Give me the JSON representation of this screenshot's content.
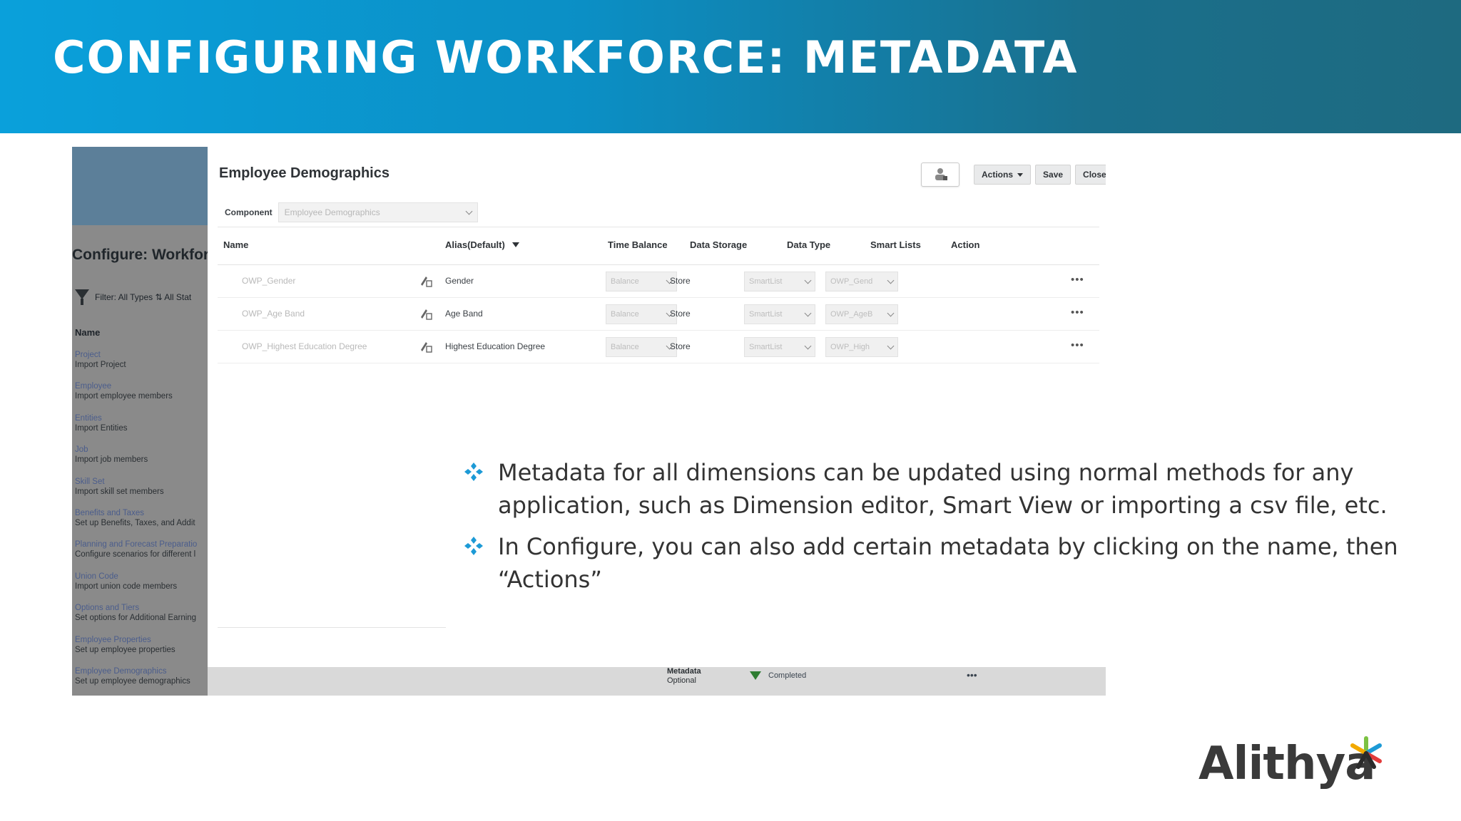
{
  "slide": {
    "title": "CONFIGURING WORKFORCE: METADATA",
    "header_gradient": [
      "#0aa0db",
      "#1e6a80"
    ],
    "bullets": [
      "Metadata for all dimensions can be updated using normal methods for any application, such as Dimension editor, Smart View or importing a csv file, etc.",
      "In Configure, you can also add certain metadata by clicking on the name, then “Actions”"
    ],
    "bullet_color": "#1c9ad6",
    "logo_text": "Alithya"
  },
  "background_app": {
    "page_title": "Configure: Workfor",
    "filter_text": "Filter:  All Types ⇅  All Stat",
    "name_header": "Name",
    "items": [
      {
        "title": "Project",
        "desc": "Import Project"
      },
      {
        "title": "Employee",
        "desc": "Import employee members"
      },
      {
        "title": "Entities",
        "desc": "Import Entities"
      },
      {
        "title": "Job",
        "desc": "Import job members"
      },
      {
        "title": "Skill Set",
        "desc": "Import skill set members"
      },
      {
        "title": "Benefits and Taxes",
        "desc": "Set up Benefits, Taxes, and Addit"
      },
      {
        "title": "Planning and Forecast Preparatio",
        "desc": "Configure scenarios for different l"
      },
      {
        "title": "Union Code",
        "desc": "Import union code members"
      },
      {
        "title": "Options and Tiers",
        "desc": "Set options for Additional Earning"
      },
      {
        "title": "Employee Properties",
        "desc": "Set up employee properties"
      },
      {
        "title": "Employee Demographics",
        "desc": "Set up employee demographics"
      }
    ],
    "bottom_meta_title": "Metadata",
    "bottom_meta_sub": "Optional",
    "bottom_status": "Completed",
    "bottom_actions": "•••"
  },
  "dialog": {
    "title": "Employee Demographics",
    "buttons": {
      "actions": "Actions",
      "save": "Save",
      "close": "Close"
    },
    "component_label": "Component",
    "component_value": "Employee Demographics",
    "columns": [
      "Name",
      "Alias(Default)",
      "Time Balance",
      "Data Storage",
      "Data Type",
      "Smart Lists",
      "Action"
    ],
    "rows": [
      {
        "name": "OWP_Gender",
        "alias": "Gender",
        "time_balance": "Balance",
        "data_storage": "Store",
        "data_type": "SmartList",
        "smart_list": "OWP_Gend",
        "action": "•••"
      },
      {
        "name": "OWP_Age Band",
        "alias": "Age Band",
        "time_balance": "Balance",
        "data_storage": "Store",
        "data_type": "SmartList",
        "smart_list": "OWP_AgeB",
        "action": "•••"
      },
      {
        "name": "OWP_Highest Education Degree",
        "alias": "Highest Education Degree",
        "time_balance": "Balance",
        "data_storage": "Store",
        "data_type": "SmartList",
        "smart_list": "OWP_High",
        "action": "•••"
      }
    ]
  }
}
